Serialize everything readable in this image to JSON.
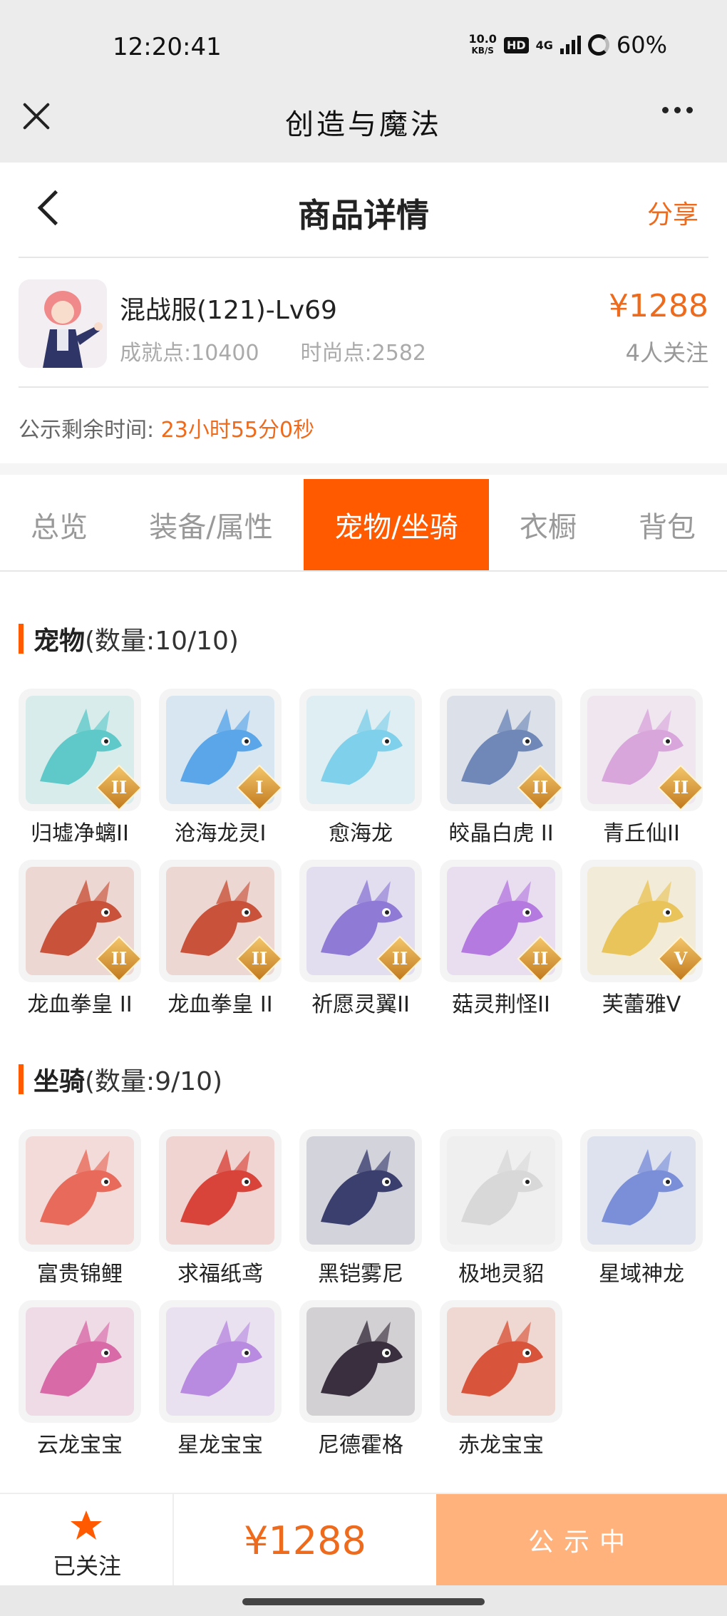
{
  "status_bar": {
    "time": "12:20:41",
    "net_speed_value": "10.0",
    "net_speed_unit": "KB/S",
    "hd": "HD",
    "network": "4G",
    "battery": "60%"
  },
  "app": {
    "title": "创造与魔法"
  },
  "header": {
    "title": "商品详情",
    "share": "分享"
  },
  "product": {
    "name": "混战服(121)-Lv69",
    "achievement": "成就点:10400",
    "fashion": "时尚点:2582",
    "price": "¥1288",
    "watchers": "4人关注"
  },
  "countdown": {
    "label": "公示剩余时间:",
    "value": "23小时55分0秒"
  },
  "tabs": [
    "总览",
    "装备/属性",
    "宠物/坐骑",
    "衣橱",
    "背包"
  ],
  "active_tab": "宠物/坐骑",
  "pets": {
    "title": "宠物",
    "count": "(数量:10/10)",
    "items": [
      {
        "name": "归墟净螭II",
        "rank": "II",
        "color": "#5fc9c9"
      },
      {
        "name": "沧海龙灵I",
        "rank": "I",
        "color": "#5aa6e8"
      },
      {
        "name": "愈海龙",
        "rank": "",
        "color": "#7fd0ea"
      },
      {
        "name": "皎晶白虎 II",
        "rank": "II",
        "color": "#6f88b8"
      },
      {
        "name": "青丘仙II",
        "rank": "II",
        "color": "#d9a6dc"
      },
      {
        "name": "龙血拳皇 II",
        "rank": "II",
        "color": "#c9523a"
      },
      {
        "name": "龙血拳皇 II",
        "rank": "II",
        "color": "#c9523a"
      },
      {
        "name": "祈愿灵翼II",
        "rank": "II",
        "color": "#8f7ad6"
      },
      {
        "name": "菇灵荆怪II",
        "rank": "II",
        "color": "#b57ae0"
      },
      {
        "name": "芙蕾雅V",
        "rank": "V",
        "color": "#e8c45a"
      }
    ]
  },
  "mounts": {
    "title": "坐骑",
    "count": "(数量:9/10)",
    "items": [
      {
        "name": "富贵锦鲤",
        "color": "#e86a5a"
      },
      {
        "name": "求福纸鸢",
        "color": "#d8443a"
      },
      {
        "name": "黑铠雾尼",
        "color": "#3b3f6e"
      },
      {
        "name": "极地灵貂",
        "color": "#d8d8d8"
      },
      {
        "name": "星域神龙",
        "color": "#7a8fd8"
      },
      {
        "name": "云龙宝宝",
        "color": "#d86aa8"
      },
      {
        "name": "星龙宝宝",
        "color": "#b88ae0"
      },
      {
        "name": "尼德霍格",
        "color": "#3a2f3e"
      },
      {
        "name": "赤龙宝宝",
        "color": "#d8543a"
      }
    ]
  },
  "bottom": {
    "follow_label": "已关注",
    "price": "¥1288",
    "button": "公示中"
  },
  "colors": {
    "accent": "#ff5a00",
    "price": "#ee6a1c",
    "button": "#ffb27c"
  }
}
